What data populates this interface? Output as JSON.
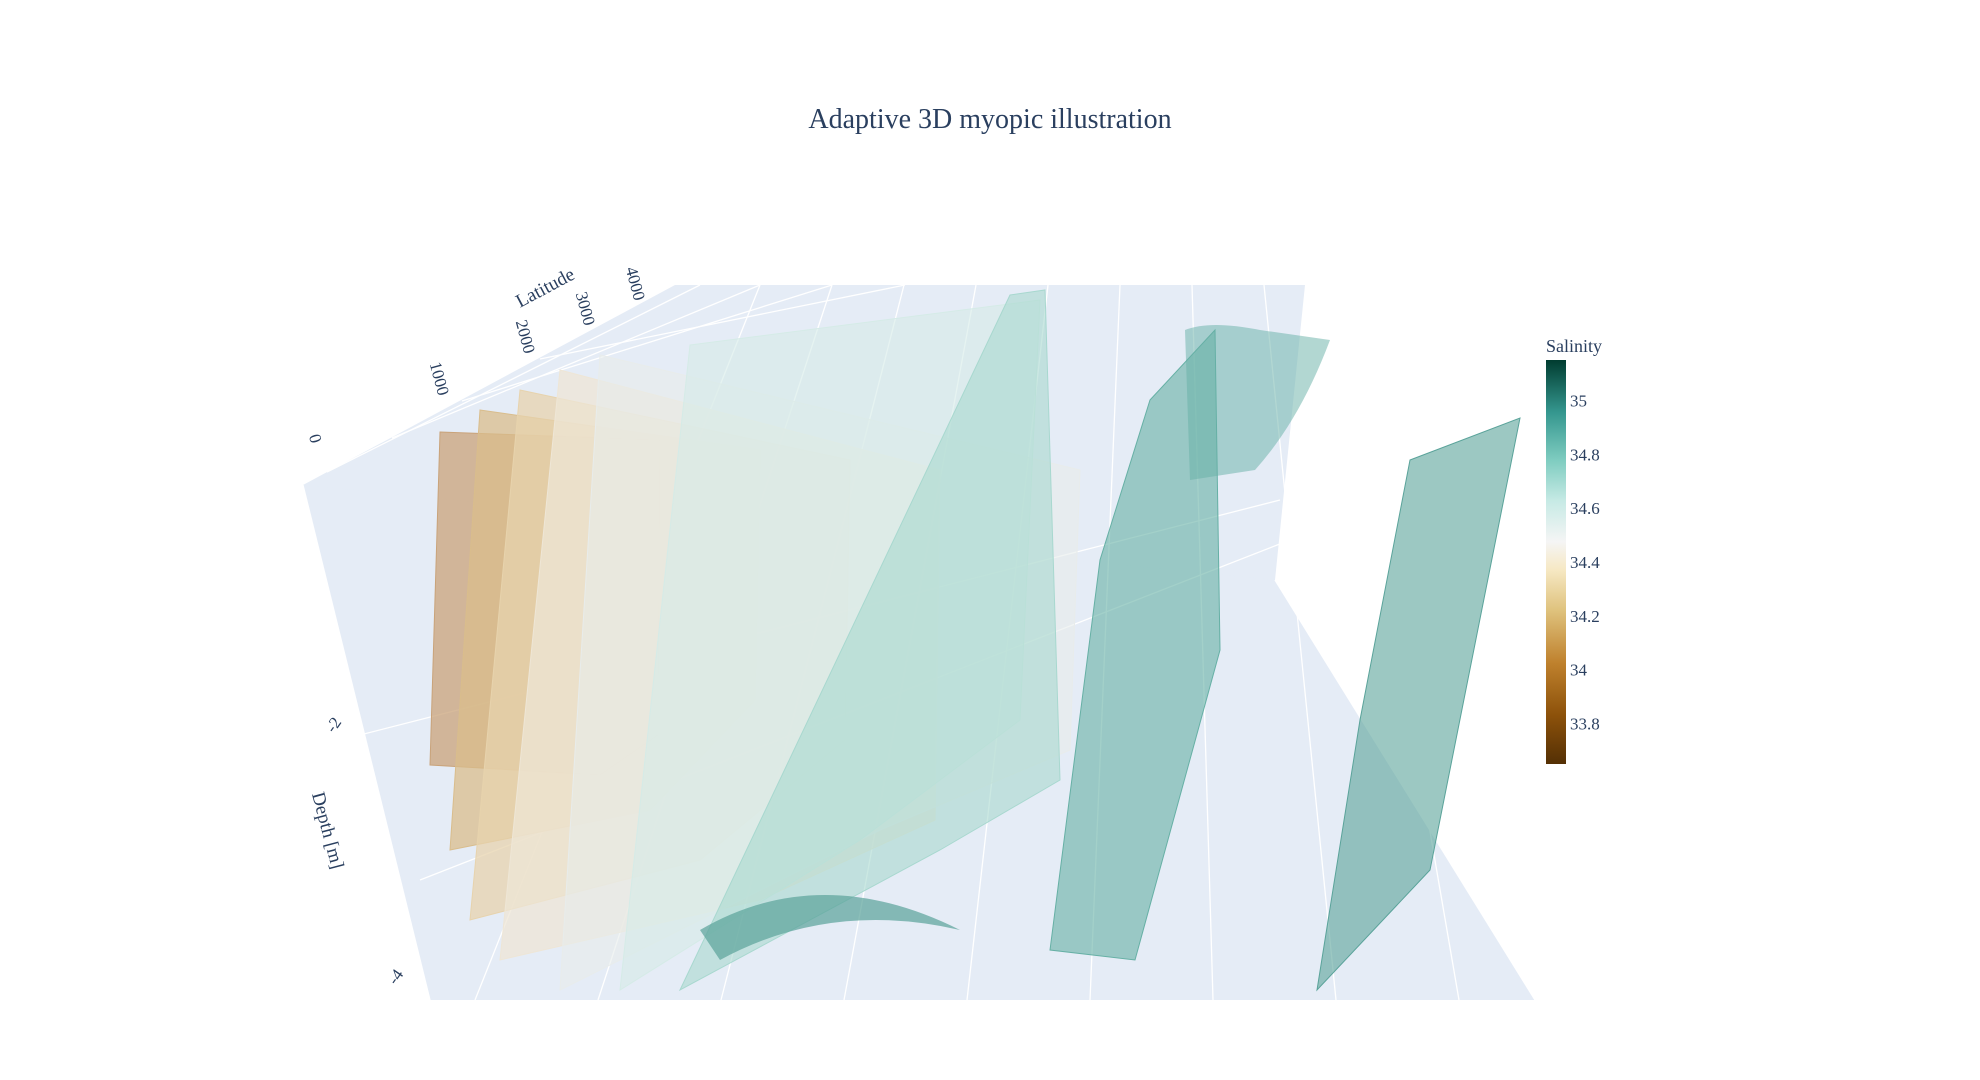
{
  "chart_data": {
    "type": "isosurface",
    "title": "Adaptive 3D myopic illustration",
    "scene": {
      "y_axis": {
        "label": "Latitude",
        "ticks": [
          "0",
          "1000",
          "2000",
          "3000",
          "4000"
        ]
      },
      "z_axis": {
        "label": "Depth [m]",
        "ticks": [
          "-2",
          "-4"
        ]
      },
      "background": "#e5ecf6",
      "gridlines": true
    },
    "colorbar": {
      "title": "Salinity",
      "colorscale": "BrBG",
      "ticks": [
        "33.8",
        "34",
        "34.2",
        "34.4",
        "34.6",
        "34.8",
        "35"
      ],
      "range": [
        33.65,
        35.15
      ]
    },
    "isosurfaces": [
      {
        "salinity": 33.95,
        "color": "#c9a37a"
      },
      {
        "salinity": 34.1,
        "color": "#d9bd8c"
      },
      {
        "salinity": 34.2,
        "color": "#e7d3ad"
      },
      {
        "salinity": 34.3,
        "color": "#eee6d6"
      },
      {
        "salinity": 34.4,
        "color": "#e8eceb"
      },
      {
        "salinity": 34.5,
        "color": "#d5ebe7"
      },
      {
        "salinity": 34.62,
        "color": "#a8d8cf"
      },
      {
        "salinity": 34.75,
        "color": "#66b0a5"
      },
      {
        "salinity": 34.8,
        "color": "#5aa39a"
      }
    ]
  }
}
